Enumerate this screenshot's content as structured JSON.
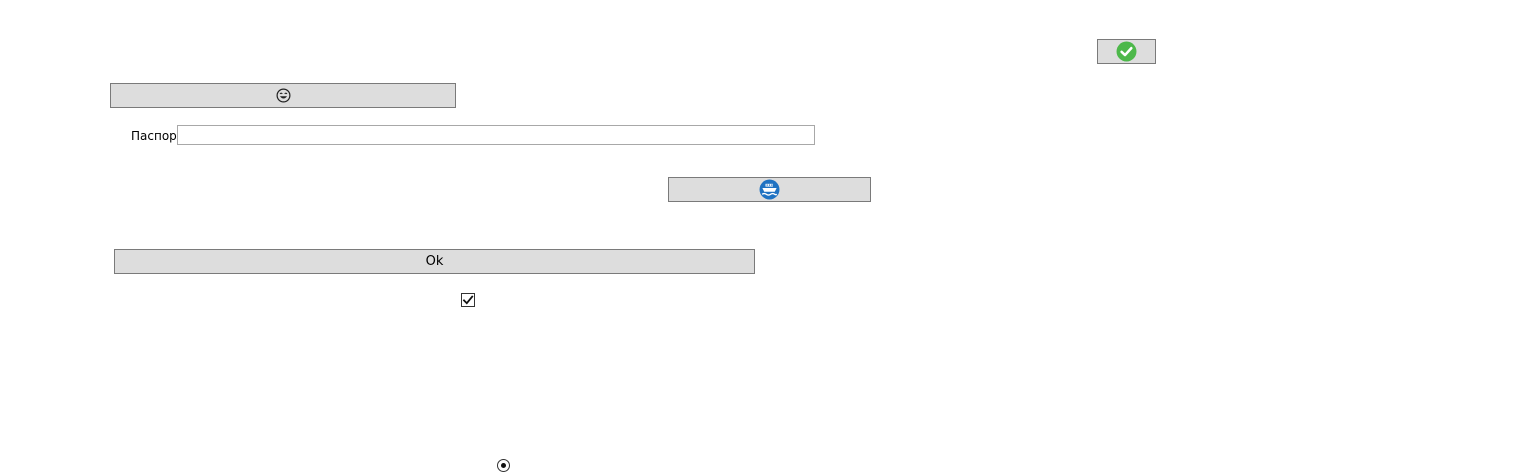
{
  "buttons": {
    "confirm": {
      "icon": "green-check-icon"
    },
    "face": {
      "icon": "smiling-face-icon"
    },
    "ship": {
      "icon": "ship-icon"
    },
    "ok": {
      "label": "Ok"
    }
  },
  "passport": {
    "label": "Паспорт",
    "value": "",
    "placeholder": ""
  },
  "checkbox": {
    "checked": true
  },
  "radio": {
    "selected": true
  },
  "colors": {
    "button_bg": "#dddddd",
    "button_border": "#7a7a7a",
    "check_green": "#4db84a",
    "ship_blue": "#1f72c2"
  }
}
